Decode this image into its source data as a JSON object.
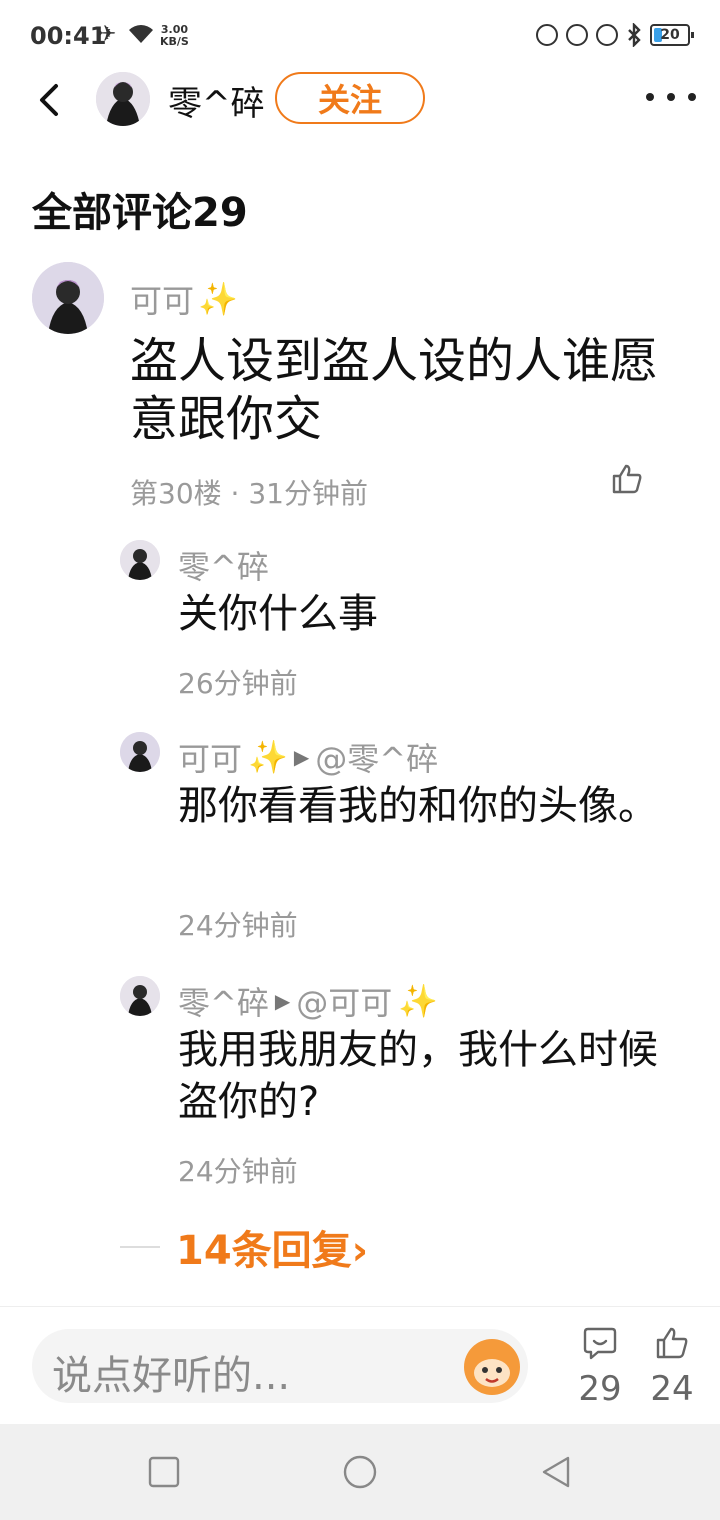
{
  "status_bar": {
    "time": "00:41",
    "speed_value": "3.00",
    "speed_unit": "KB/S",
    "battery": "20"
  },
  "header": {
    "username": "零^碎",
    "follow_label": "关注"
  },
  "section_title": "全部评论29",
  "main_comment": {
    "author": "可可",
    "text": "盗人设到盗人设的人谁愿意跟你交",
    "meta": "第30楼 · 31分钟前"
  },
  "replies": [
    {
      "author": "零^碎",
      "reply_to": "",
      "text": "关你什么事",
      "time": "26分钟前"
    },
    {
      "author": "可可",
      "reply_to": "@零^碎",
      "text": "那你看看我的和你的头像。",
      "time": "24分钟前"
    },
    {
      "author": "零^碎",
      "reply_to": "@可可",
      "text": "我用我朋友的，我什么时候盗你的?",
      "time": "24分钟前"
    }
  ],
  "more_replies_label": "14条回复›",
  "bottom_bar": {
    "input_placeholder": "说点好听的...",
    "comment_count": "29",
    "like_count": "24"
  },
  "colors": {
    "accent": "#f07a1a",
    "muted_text": "#9a9a9a",
    "sparkle": "#f5d43b"
  }
}
